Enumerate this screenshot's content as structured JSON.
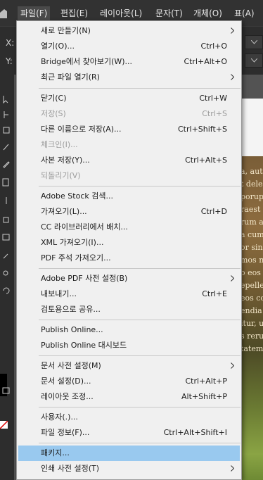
{
  "menubar": {
    "items": [
      {
        "label": "파일(F)",
        "active": true
      },
      {
        "label": "편집(E)"
      },
      {
        "label": "레이아웃(L)"
      },
      {
        "label": "문자(T)"
      },
      {
        "label": "개체(O)"
      },
      {
        "label": "표(A)"
      }
    ]
  },
  "controls": {
    "x_label": "X:",
    "y_label": "Y:"
  },
  "canvas_text": [
    "a, aut",
    "t dele",
    "porup",
    "raest",
    "rum a",
    "a cum",
    "or sin",
    "mos n",
    "o eos",
    "epeller",
    "eos co",
    "endia",
    "itur, u",
    "s rerus",
    "tatem"
  ],
  "menu": {
    "items": [
      {
        "label": "새로 만들기(N)",
        "shortcut": "",
        "submenu": true
      },
      {
        "label": "열기(O)...",
        "shortcut": "Ctrl+O"
      },
      {
        "label": "Bridge에서 찾아보기(W)...",
        "shortcut": "Ctrl+Alt+O"
      },
      {
        "label": "최근 파일 열기(R)",
        "shortcut": "",
        "submenu": true
      },
      {
        "label": "닫기(C)",
        "shortcut": "Ctrl+W"
      },
      {
        "label": "저장(S)",
        "shortcut": "Ctrl+S",
        "disabled": true
      },
      {
        "label": "다른 이름으로 저장(A)...",
        "shortcut": "Ctrl+Shift+S"
      },
      {
        "label": "체크인(I)...",
        "shortcut": "",
        "disabled": true
      },
      {
        "label": "사본 저장(Y)...",
        "shortcut": "Ctrl+Alt+S"
      },
      {
        "label": "되돌리기(V)",
        "shortcut": "",
        "disabled": true
      },
      {
        "label": "Adobe Stock 검색...",
        "shortcut": ""
      },
      {
        "label": "가져오기(L)...",
        "shortcut": "Ctrl+D"
      },
      {
        "label": "CC 라이브러리에서 배치...",
        "shortcut": ""
      },
      {
        "label": "XML 가져오기(I)...",
        "shortcut": ""
      },
      {
        "label": "PDF 주석 가져오기...",
        "shortcut": ""
      },
      {
        "label": "Adobe PDF 사전 설정(B)",
        "shortcut": "",
        "submenu": true
      },
      {
        "label": "내보내기...",
        "shortcut": "Ctrl+E"
      },
      {
        "label": "검토용으로 공유...",
        "shortcut": ""
      },
      {
        "label": "Publish Online...",
        "shortcut": ""
      },
      {
        "label": "Publish Online 대시보드",
        "shortcut": ""
      },
      {
        "label": "문서 사전 설정(M)",
        "shortcut": "",
        "submenu": true
      },
      {
        "label": "문서 설정(D)...",
        "shortcut": "Ctrl+Alt+P"
      },
      {
        "label": "레이아웃 조정...",
        "shortcut": "Alt+Shift+P"
      },
      {
        "label": "사용자(.)...",
        "shortcut": ""
      },
      {
        "label": "파일 정보(F)...",
        "shortcut": "Ctrl+Alt+Shift+I"
      },
      {
        "label": "패키지...",
        "shortcut": "",
        "highlighted": true
      },
      {
        "label": "인쇄 사전 설정(T)",
        "shortcut": "",
        "submenu": true
      }
    ]
  }
}
